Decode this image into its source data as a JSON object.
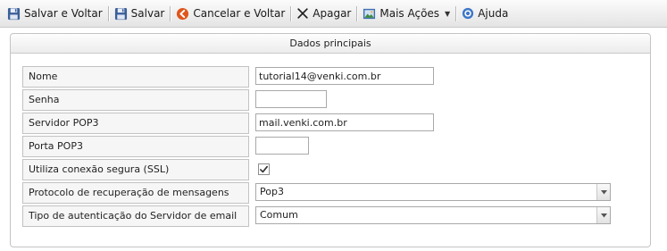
{
  "toolbar": {
    "save_back_label": "Salvar e Voltar",
    "save_label": "Salvar",
    "cancel_back_label": "Cancelar e Voltar",
    "delete_label": "Apagar",
    "more_actions_label": "Mais Ações",
    "help_label": "Ajuda"
  },
  "panel": {
    "title": "Dados principais"
  },
  "form": {
    "nome": {
      "label": "Nome",
      "value": "tutorial14@venki.com.br"
    },
    "senha": {
      "label": "Senha",
      "value": ""
    },
    "servidor_pop3": {
      "label": "Servidor POP3",
      "value": "mail.venki.com.br"
    },
    "porta_pop3": {
      "label": "Porta POP3",
      "value": ""
    },
    "ssl": {
      "label": "Utiliza conexão segura (SSL)",
      "checked": true
    },
    "protocolo": {
      "label": "Protocolo de recuperação de mensagens",
      "value": "Pop3"
    },
    "autenticacao": {
      "label": "Tipo de autenticação do Servidor de email",
      "value": "Comum"
    }
  },
  "colors": {
    "save_icon": "#3a5f9a",
    "cancel_icon": "#e0551c",
    "help_icon": "#3f77c8"
  }
}
